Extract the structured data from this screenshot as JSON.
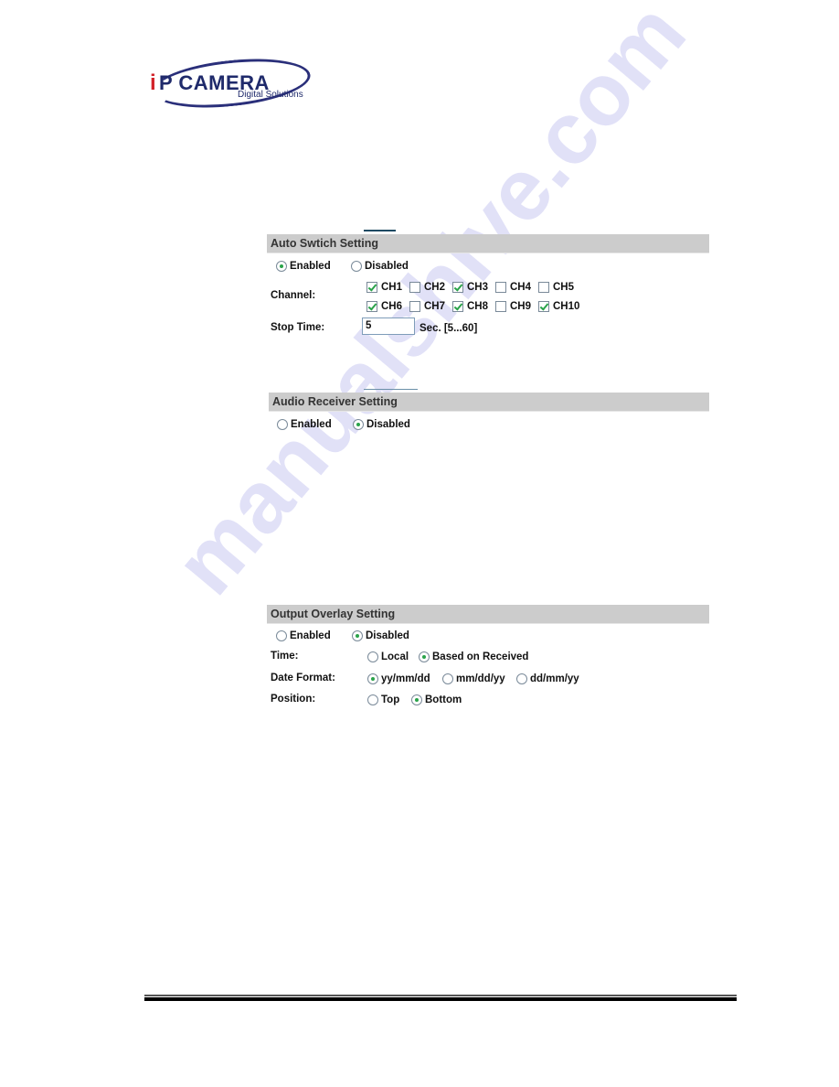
{
  "logo": {
    "prefix": "i",
    "main": "P CAMERA",
    "subtitle": "Digital Solutions"
  },
  "watermark": "manualshive.com",
  "auto_switch": {
    "title": "Auto Swtich Setting",
    "mode_options": [
      {
        "label": "Enabled",
        "selected": true
      },
      {
        "label": "Disabled",
        "selected": false
      }
    ],
    "channel_label": "Channel:",
    "channels": [
      {
        "label": "CH1",
        "checked": true
      },
      {
        "label": "CH2",
        "checked": false
      },
      {
        "label": "CH3",
        "checked": true
      },
      {
        "label": "CH4",
        "checked": false
      },
      {
        "label": "CH5",
        "checked": false
      },
      {
        "label": "CH6",
        "checked": true
      },
      {
        "label": "CH7",
        "checked": false
      },
      {
        "label": "CH8",
        "checked": true
      },
      {
        "label": "CH9",
        "checked": false
      },
      {
        "label": "CH10",
        "checked": true
      }
    ],
    "stop_time_label": "Stop Time:",
    "stop_time_value": "5",
    "stop_time_unit": "Sec. [5...60]"
  },
  "audio_receiver": {
    "title": "Audio Receiver Setting",
    "mode_options": [
      {
        "label": "Enabled",
        "selected": false
      },
      {
        "label": "Disabled",
        "selected": true
      }
    ]
  },
  "output_overlay": {
    "title": "Output Overlay Setting",
    "mode_options": [
      {
        "label": "Enabled",
        "selected": false
      },
      {
        "label": "Disabled",
        "selected": true
      }
    ],
    "time_label": "Time:",
    "time_options": [
      {
        "label": "Local",
        "selected": false
      },
      {
        "label": "Based on Received",
        "selected": true
      }
    ],
    "date_format_label": "Date Format:",
    "date_format_options": [
      {
        "label": "yy/mm/dd",
        "selected": true
      },
      {
        "label": "mm/dd/yy",
        "selected": false
      },
      {
        "label": "dd/mm/yy",
        "selected": false
      }
    ],
    "position_label": "Position:",
    "position_options": [
      {
        "label": "Top",
        "selected": false
      },
      {
        "label": "Bottom",
        "selected": true
      }
    ]
  }
}
